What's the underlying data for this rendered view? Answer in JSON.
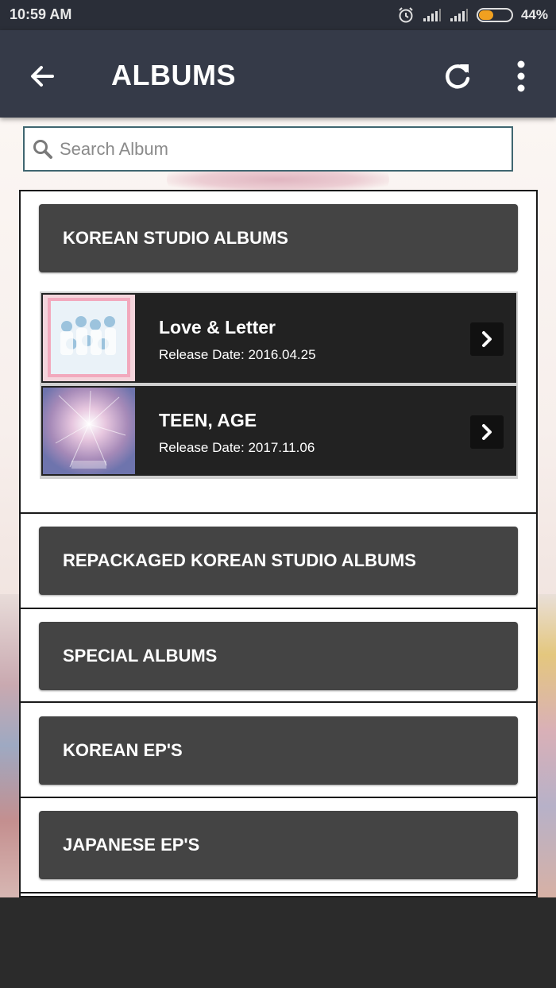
{
  "status_bar": {
    "time": "10:59 AM",
    "battery_percent": "44%",
    "battery_level": 0.44,
    "icons": [
      "alarm-icon",
      "signal-icon",
      "signal-icon",
      "battery-icon"
    ]
  },
  "app_bar": {
    "title": "ALBUMS",
    "back_icon": "arrow-left-icon",
    "refresh_icon": "refresh-icon",
    "menu_icon": "more-vertical-icon"
  },
  "search": {
    "placeholder": "Search Album",
    "value": "",
    "icon": "search-icon"
  },
  "sections": [
    {
      "title": "KOREAN STUDIO ALBUMS",
      "expanded": true,
      "albums": [
        {
          "name": "Love & Letter",
          "release": "Release Date: 2016.04.25",
          "cover_colors": [
            "#f3c7d2",
            "#bcd9ea"
          ]
        },
        {
          "name": "TEEN, AGE",
          "release": "Release Date: 2017.11.06",
          "cover_colors": [
            "#b28fb5",
            "#7a7fb6"
          ]
        }
      ]
    },
    {
      "title": "REPACKAGED KOREAN STUDIO ALBUMS",
      "expanded": false
    },
    {
      "title": "SPECIAL ALBUMS",
      "expanded": false
    },
    {
      "title": "KOREAN EP'S",
      "expanded": false
    },
    {
      "title": "JAPANESE EP'S",
      "expanded": false
    }
  ],
  "colors": {
    "app_bar": "#353a48",
    "section_header": "#444444",
    "album_row": "#222222",
    "search_border": "#3f6670",
    "battery_fill": "#f0a020"
  }
}
